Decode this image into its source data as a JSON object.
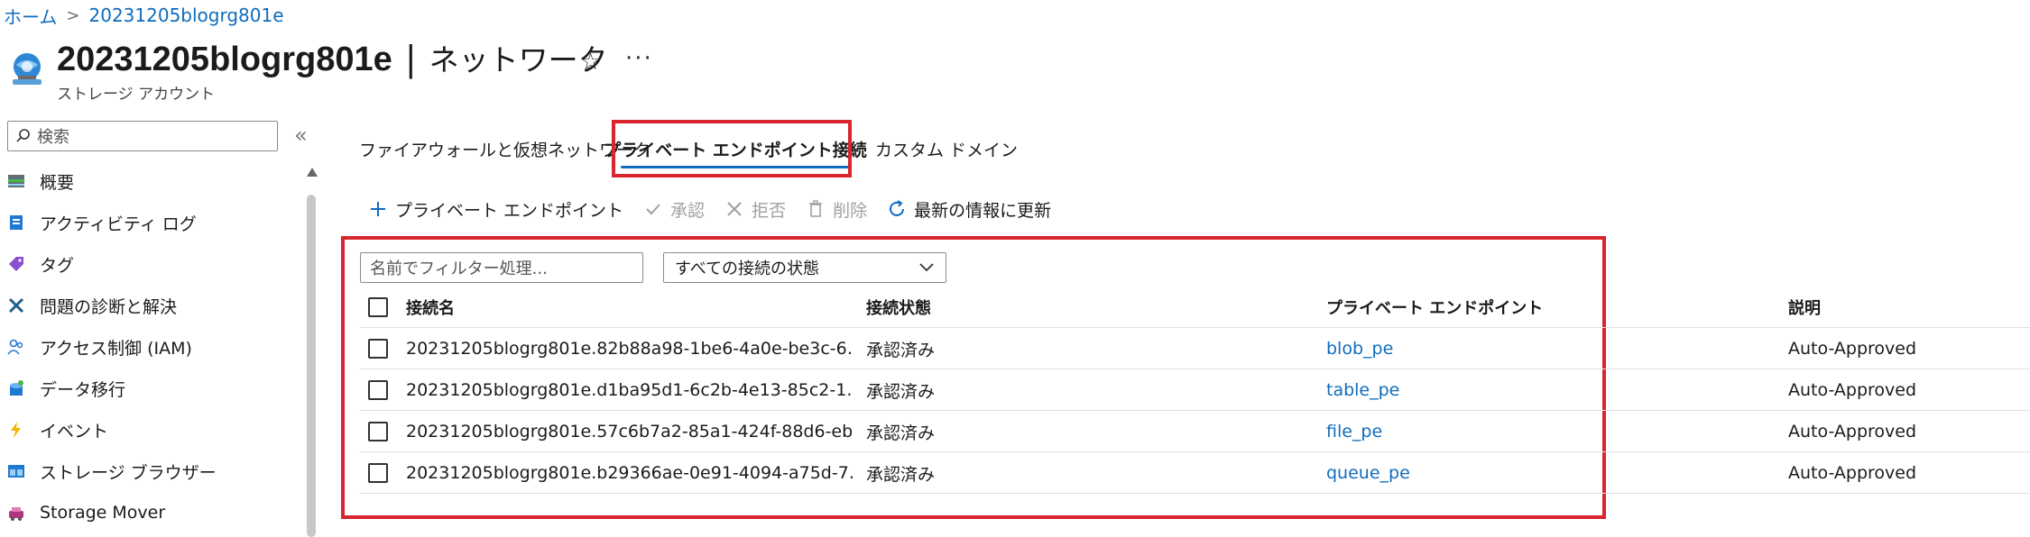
{
  "breadcrumb": {
    "home": "ホーム",
    "separator": ">",
    "current": "20231205blogrg801e"
  },
  "header": {
    "resource_name": "20231205blogrg801e",
    "divider": "|",
    "page_name": "ネットワーク",
    "subtitle": "ストレージ アカウント",
    "favorite_icon": "star-icon",
    "more_icon": "ellipsis-icon",
    "more_label": "···"
  },
  "sidebar": {
    "search_placeholder": "検索",
    "collapse_label": "«",
    "items": [
      {
        "label": "概要",
        "icon": "overview-icon"
      },
      {
        "label": "アクティビティ ログ",
        "icon": "activity-log-icon"
      },
      {
        "label": "タグ",
        "icon": "tag-icon"
      },
      {
        "label": "問題の診断と解決",
        "icon": "wrench-icon"
      },
      {
        "label": "アクセス制御 (IAM)",
        "icon": "people-icon"
      },
      {
        "label": "データ移行",
        "icon": "data-migration-icon"
      },
      {
        "label": "イベント",
        "icon": "lightning-icon"
      },
      {
        "label": "ストレージ ブラウザー",
        "icon": "storage-browser-icon"
      },
      {
        "label": "Storage Mover",
        "icon": "storage-mover-icon"
      }
    ]
  },
  "tabs": [
    {
      "label": "ファイアウォールと仮想ネットワーク",
      "active": false
    },
    {
      "label": "プライベート エンドポイント接続",
      "active": true
    },
    {
      "label": "カスタム ドメイン",
      "active": false
    }
  ],
  "toolbar": {
    "add_label": "プライベート エンドポイント",
    "approve_label": "承認",
    "reject_label": "拒否",
    "delete_label": "削除",
    "refresh_label": "最新の情報に更新"
  },
  "filter": {
    "name_placeholder": "名前でフィルター処理...",
    "status_selected": "すべての接続の状態"
  },
  "table": {
    "columns": [
      "接続名",
      "接続状態",
      "プライベート エンドポイント",
      "説明"
    ],
    "rows": [
      {
        "name": "20231205blogrg801e.82b88a98-1be6-4a0e-be3c-6…",
        "state": "承認済み",
        "endpoint": "blob_pe",
        "description": "Auto-Approved"
      },
      {
        "name": "20231205blogrg801e.d1ba95d1-6c2b-4e13-85c2-1…",
        "state": "承認済み",
        "endpoint": "table_pe",
        "description": "Auto-Approved"
      },
      {
        "name": "20231205blogrg801e.57c6b7a2-85a1-424f-88d6-eb…",
        "state": "承認済み",
        "endpoint": "file_pe",
        "description": "Auto-Approved"
      },
      {
        "name": "20231205blogrg801e.b29366ae-0e91-4094-a75d-7…",
        "state": "承認済み",
        "endpoint": "queue_pe",
        "description": "Auto-Approved"
      }
    ]
  },
  "colors": {
    "link": "#0f6cbd",
    "highlight": "#d9252e",
    "tab_underline": "#0f6cbd"
  }
}
